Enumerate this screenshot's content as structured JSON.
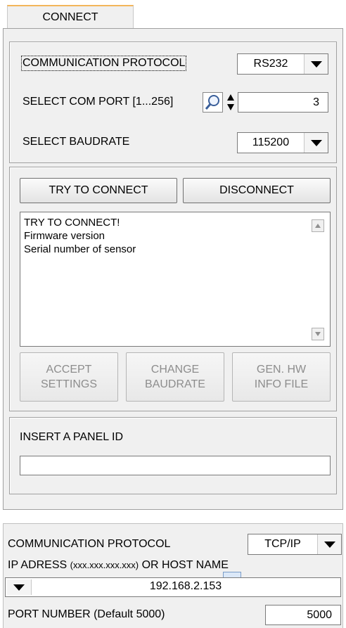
{
  "tab": {
    "label": "CONNECT"
  },
  "protocol_group": {
    "protocol_label": "COMMUNICATION PROTOCOL",
    "protocol_value": "RS232",
    "com_port_label": "SELECT COM PORT [1...256]",
    "com_port_value": "3",
    "baudrate_label": "SELECT BAUDRATE",
    "baudrate_value": "115200"
  },
  "connect_group": {
    "try_connect_label": "TRY TO CONNECT",
    "disconnect_label": "DISCONNECT",
    "log_lines": [
      "TRY TO CONNECT!",
      "Firmware version",
      "Serial number of sensor"
    ],
    "accept_label": [
      "ACCEPT",
      "SETTINGS"
    ],
    "change_baud_label": [
      "CHANGE",
      "BAUDRATE"
    ],
    "gen_hw_label": [
      "GEN. HW",
      "INFO FILE"
    ]
  },
  "panel_id_group": {
    "label": "INSERT A PANEL ID",
    "value": ""
  },
  "tcp_section": {
    "protocol_label": "COMMUNICATION PROTOCOL",
    "protocol_value": "TCP/IP",
    "ip_label_prefix": "IP ADRESS ",
    "ip_label_format": "(xxx.xxx.xxx.xxx)",
    "ip_label_suffix": " OR HOST NAME",
    "ip_value": "192.168.2.153",
    "port_label": "PORT NUMBER (Default 5000)",
    "port_value": "5000"
  },
  "icons": {
    "search": "magnifier-icon",
    "spinner": "spinner-arrows-icon",
    "dropdown": "triangle-down-icon"
  }
}
